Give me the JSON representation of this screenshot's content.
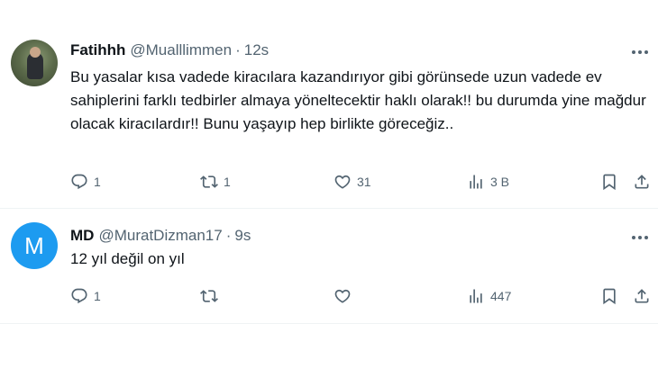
{
  "tweets": [
    {
      "name": "Fatihhh",
      "handle": "@Mualllimmen",
      "separator": "·",
      "time": "12s",
      "text": "Bu yasalar kısa vadede kiracılara kazandırıyor gibi görünsede uzun vadede ev sahiplerini farklı tedbirler almaya yöneltecektir haklı olarak!! bu durumda yine mağdur olacak kiracılardır!! Bunu yaşayıp hep birlikte göreceğiz..",
      "replies": "1",
      "retweets": "1",
      "likes": "31",
      "views": "3 B",
      "avatar_icon": "profile-photo"
    },
    {
      "name": "MD",
      "handle": "@MuratDizman17",
      "separator": "·",
      "time": "9s",
      "text": "12 yıl değil on yıl",
      "replies": "1",
      "retweets": "",
      "likes": "",
      "views": "447",
      "avatar_letter": "M"
    }
  ],
  "colors": {
    "text": "#0f1419",
    "secondary": "#536471",
    "avatar_bg": "#1d9bf0",
    "divider": "#eff3f4"
  },
  "icons": [
    "reply-icon",
    "retweet-icon",
    "like-icon",
    "views-icon",
    "bookmark-icon",
    "share-icon",
    "more-icon"
  ]
}
